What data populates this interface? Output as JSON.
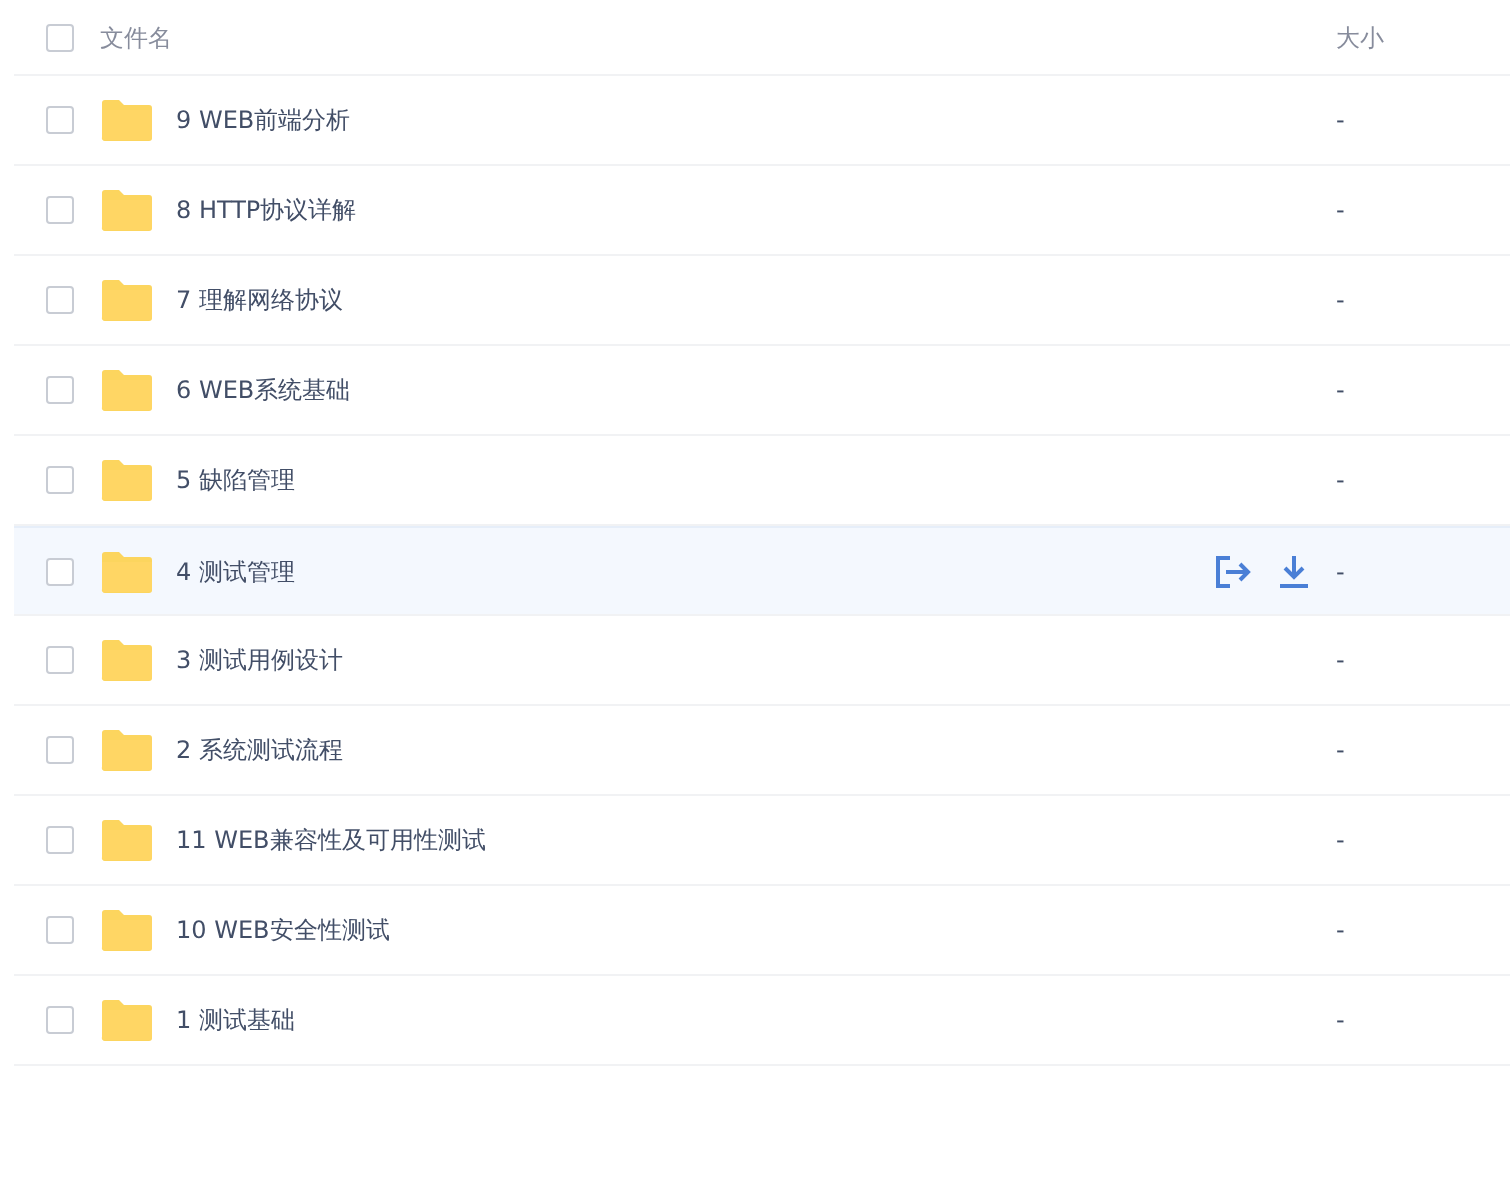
{
  "header": {
    "select_all_checked": false,
    "columns": [
      "文件名",
      "大小"
    ]
  },
  "rows": [
    {
      "name": "9 WEB前端分析",
      "size": "-",
      "checked": false,
      "hovered": false
    },
    {
      "name": "8 HTTP协议详解",
      "size": "-",
      "checked": false,
      "hovered": false
    },
    {
      "name": "7 理解网络协议",
      "size": "-",
      "checked": false,
      "hovered": false
    },
    {
      "name": "6 WEB系统基础",
      "size": "-",
      "checked": false,
      "hovered": false
    },
    {
      "name": "5 缺陷管理",
      "size": "-",
      "checked": false,
      "hovered": false
    },
    {
      "name": "4 测试管理",
      "size": "-",
      "checked": false,
      "hovered": true
    },
    {
      "name": "3 测试用例设计",
      "size": "-",
      "checked": false,
      "hovered": false
    },
    {
      "name": "2 系统测试流程",
      "size": "-",
      "checked": false,
      "hovered": false
    },
    {
      "name": "11 WEB兼容性及可用性测试",
      "size": "-",
      "checked": false,
      "hovered": false
    },
    {
      "name": "10 WEB安全性测试",
      "size": "-",
      "checked": false,
      "hovered": false
    },
    {
      "name": "1 测试基础",
      "size": "-",
      "checked": false,
      "hovered": false
    }
  ]
}
